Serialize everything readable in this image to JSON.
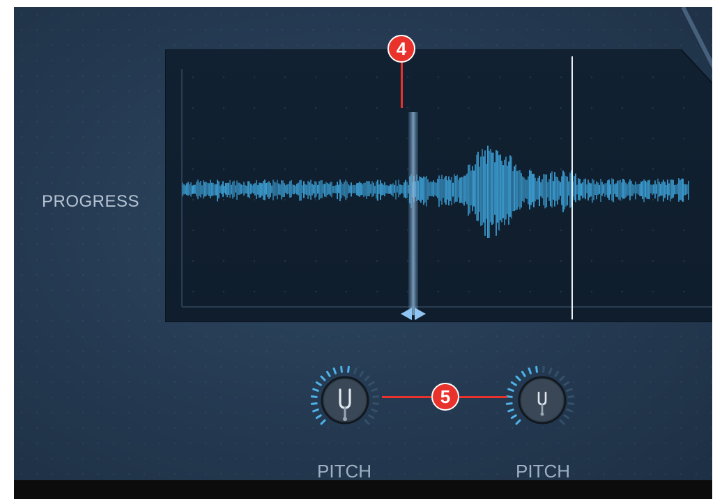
{
  "labels": {
    "progress": "PROGRESS",
    "pitch_left": "PITCH",
    "pitch_right": "PITCH"
  },
  "markers": {
    "marker_4": "4",
    "marker_5": "5"
  },
  "icons": {
    "knob_left": "tuning-fork-icon",
    "knob_right": "tuning-fork-icon",
    "playhead_handle": "left-right-arrows-icon"
  },
  "colors": {
    "background": "#263c54",
    "waveform": "#3fa7df",
    "marker": "#e8322b",
    "knob_ring_active": "#4fb3ea"
  }
}
